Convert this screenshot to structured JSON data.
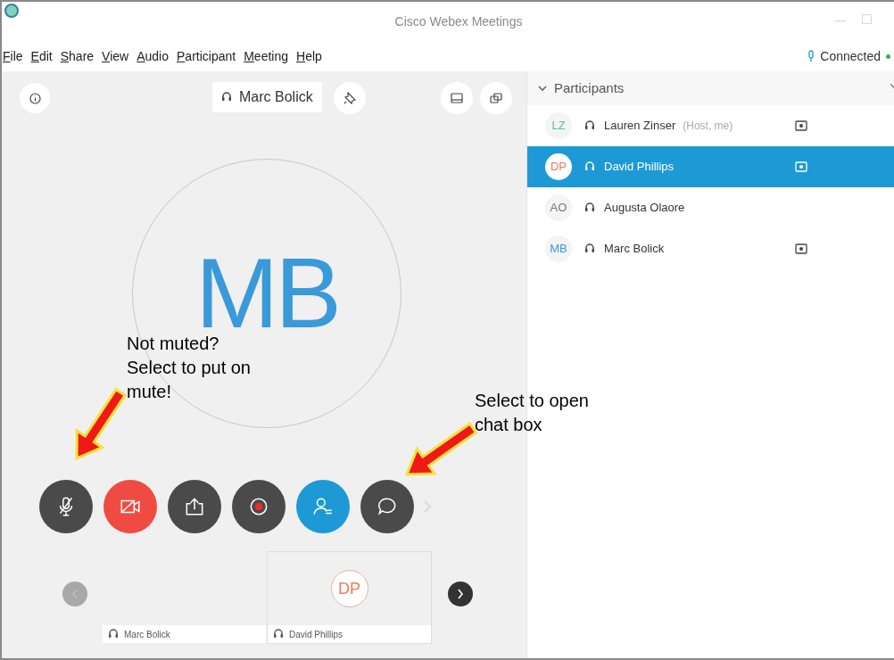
{
  "window": {
    "title": "Cisco Webex Meetings"
  },
  "menu": [
    {
      "label": "File"
    },
    {
      "label": "Edit"
    },
    {
      "label": "Share"
    },
    {
      "label": "View"
    },
    {
      "label": "Audio"
    },
    {
      "label": "Participant"
    },
    {
      "label": "Meeting"
    },
    {
      "label": "Help"
    }
  ],
  "connection": {
    "label": "Connected",
    "color": "#2db34a"
  },
  "stage": {
    "speaker": "Marc Bolick",
    "initials": "MB"
  },
  "controls": [
    {
      "kind": "mute",
      "color": "#4a4a4a"
    },
    {
      "kind": "video",
      "color": "#ef4b43"
    },
    {
      "kind": "share",
      "color": "#4a4a4a"
    },
    {
      "kind": "record",
      "color": "#4a4a4a"
    },
    {
      "kind": "participants",
      "color": "#1d9ad6"
    },
    {
      "kind": "chat",
      "color": "#4a4a4a"
    }
  ],
  "filmstrip": [
    {
      "name": "Marc Bolick",
      "selected": false
    },
    {
      "name": "David Phillips",
      "initials": "DP",
      "selected": true
    }
  ],
  "participants_panel": {
    "title": "Participants",
    "expanded": true,
    "rows": [
      {
        "initials": "LZ",
        "name": "Lauren Zinser",
        "note": "(Host, me)",
        "color": "#5fb8b0",
        "selected": false,
        "video": true
      },
      {
        "initials": "DP",
        "name": "David Phillips",
        "color": "#ef7a5a",
        "selected": true,
        "video": true
      },
      {
        "initials": "AO",
        "name": "Augusta Olaore",
        "color": "#777777",
        "selected": false,
        "video": false
      },
      {
        "initials": "MB",
        "name": "Marc Bolick",
        "color": "#3a9ad9",
        "selected": false,
        "video": true
      }
    ]
  },
  "annotations": [
    {
      "text": "Not muted? Select to put on mute!"
    },
    {
      "text": "Select to open chat box"
    }
  ]
}
